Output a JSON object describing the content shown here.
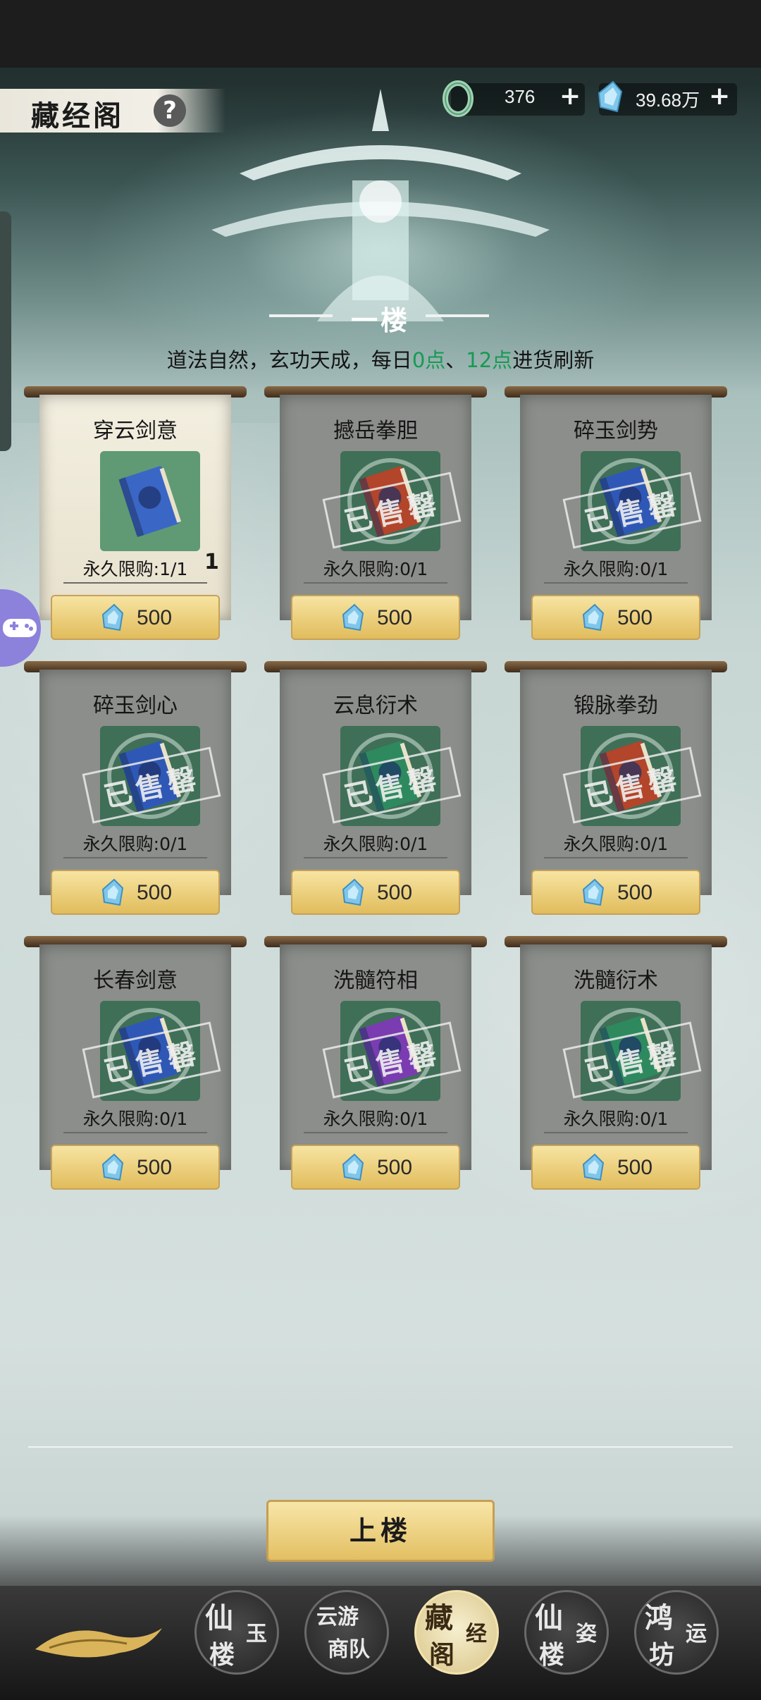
{
  "header": {
    "title": "藏经阁",
    "help_icon": "?"
  },
  "currencies": [
    {
      "icon": "jade-ring-icon",
      "value": "376",
      "plus": "+"
    },
    {
      "icon": "spirit-crystal-icon",
      "value": "39.68万",
      "plus": "+"
    }
  ],
  "floor": {
    "name": "一楼",
    "refresh_prefix": "道法自然，玄功天成，每日",
    "refresh_time1": "0点",
    "refresh_sep": "、",
    "refresh_time2": "12点",
    "refresh_suffix": "进货刷新"
  },
  "items": [
    {
      "name": "穿云剑意",
      "limit": "永久限购:1/1",
      "price": "500",
      "qty": "1",
      "sold_out": false,
      "book_color": "#3a67c6"
    },
    {
      "name": "撼岳拳胆",
      "limit": "永久限购:0/1",
      "price": "500",
      "qty": "",
      "sold_out": true,
      "book_color": "#b2452a"
    },
    {
      "name": "碎玉剑势",
      "limit": "永久限购:0/1",
      "price": "500",
      "qty": "",
      "sold_out": true,
      "book_color": "#2f58b6"
    },
    {
      "name": "碎玉剑心",
      "limit": "永久限购:0/1",
      "price": "500",
      "qty": "",
      "sold_out": true,
      "book_color": "#2f58b6"
    },
    {
      "name": "云息衍术",
      "limit": "永久限购:0/1",
      "price": "500",
      "qty": "",
      "sold_out": true,
      "book_color": "#2e8a5e"
    },
    {
      "name": "锻脉拳劲",
      "limit": "永久限购:0/1",
      "price": "500",
      "qty": "",
      "sold_out": true,
      "book_color": "#b2452a"
    },
    {
      "name": "长春剑意",
      "limit": "永久限购:0/1",
      "price": "500",
      "qty": "",
      "sold_out": true,
      "book_color": "#2f58b6"
    },
    {
      "name": "洗髓符相",
      "limit": "永久限购:0/1",
      "price": "500",
      "qty": "",
      "sold_out": true,
      "book_color": "#7a3cb0"
    },
    {
      "name": "洗髓衍术",
      "limit": "永久限购:0/1",
      "price": "500",
      "qty": "",
      "sold_out": true,
      "book_color": "#2e8a5e"
    }
  ],
  "sold_stamp": "已售罄",
  "upstairs_button": "上楼",
  "bottom_nav": [
    {
      "big": "仙",
      "small1": "玉",
      "small2": "楼",
      "active": false
    },
    {
      "big": "云游",
      "small1": "",
      "small2": "商队",
      "active": false
    },
    {
      "big": "藏",
      "small1": "经",
      "small2": "阁",
      "active": true
    },
    {
      "big": "仙",
      "small1": "姿",
      "small2": "楼",
      "active": false
    },
    {
      "big": "鸿",
      "small1": "运",
      "small2": "坊",
      "active": false
    }
  ]
}
